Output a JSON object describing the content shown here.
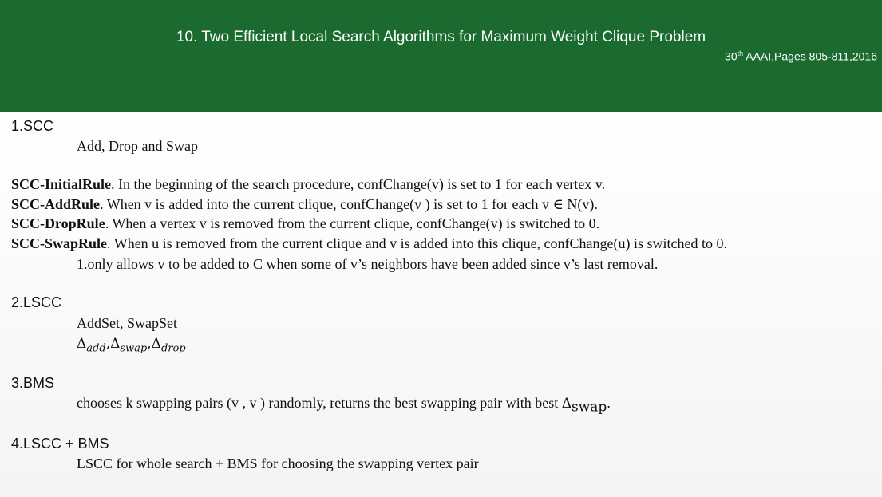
{
  "header": {
    "title": "10. Two Efficient Local Search Algorithms for Maximum Weight Clique Problem",
    "venue_ord_num": "30",
    "venue_ord_sup": "th",
    "venue_rest": " AAAI,Pages 805-811,2016"
  },
  "sections": {
    "scc": {
      "title": "1.SCC",
      "subtitle": "Add, Drop and Swap",
      "rules": [
        {
          "name": "SCC-InitialRule",
          "text": ". In the beginning of the search procedure, confChange(v) is set to 1 for each vertex v."
        },
        {
          "name": "SCC-AddRule",
          "text": ". When v is added into the current clique, confChange(v ) is set to 1  for each v ∈ N(v)."
        },
        {
          "name": "SCC-DropRule",
          "text": ". When a vertex v is removed from the current clique, confChange(v) is switched to 0."
        },
        {
          "name": "SCC-SwapRule",
          "text": ". When u is removed from the current clique and v is added into this clique, confChange(u) is switched to 0."
        }
      ],
      "note": "1.only allows v to be added to C when some of  v’s neighbors have been added since v’s last removal."
    },
    "lscc": {
      "title": "2.LSCC",
      "line1": "AddSet, SwapSet",
      "delta": "Δ",
      "subs": [
        "add",
        "swap",
        "drop"
      ],
      "sep": ","
    },
    "bms": {
      "title": "3.BMS",
      "text": "chooses k swapping pairs (v , v ) randomly, returns the best swapping pair with best ",
      "delta": "Δ",
      "sub": "swap",
      "end": "."
    },
    "lscc_bms": {
      "title": "4.LSCC + BMS",
      "text": "LSCC for whole search + BMS for choosing the swapping vertex pair"
    }
  }
}
